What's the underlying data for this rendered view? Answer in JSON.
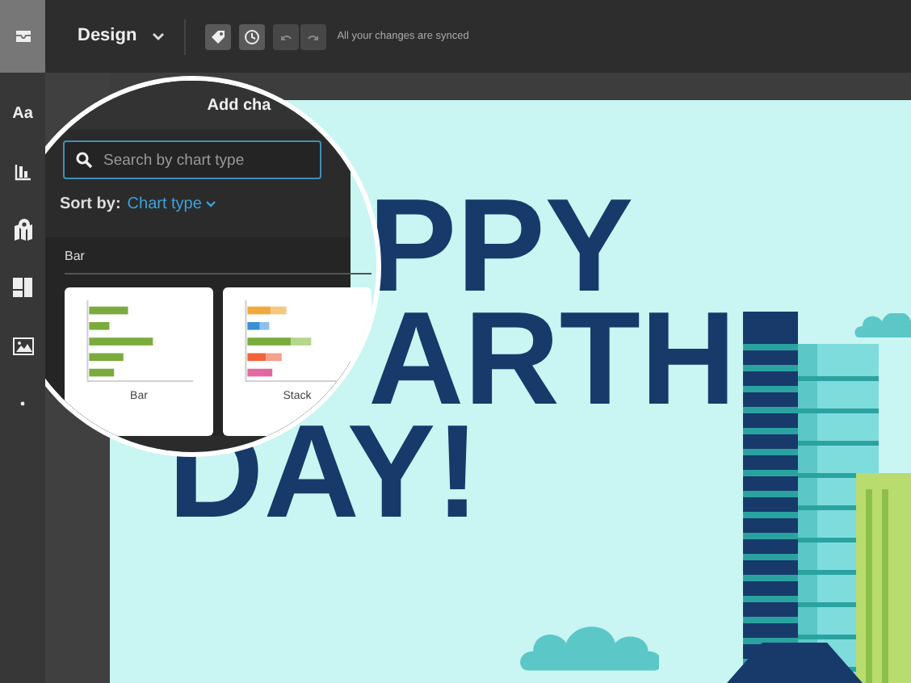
{
  "toolbar": {
    "menu_label": "Design",
    "history_buttons": [
      {
        "kind": "undo",
        "disabled": true
      },
      {
        "kind": "redo",
        "disabled": true
      }
    ],
    "sync_status": "All your changes are synced"
  },
  "rail": {
    "text_tool_label": "Aa"
  },
  "panel": {
    "title": "Add cha",
    "search": {
      "placeholder": "Search by chart type"
    },
    "sort_label": "Sort by:",
    "sort_value": "Chart type",
    "section": "Bar",
    "cards": [
      {
        "label": "Bar",
        "kind": "bar"
      },
      {
        "label": "Stack",
        "kind": "stacked"
      }
    ]
  },
  "poster": {
    "lines": [
      "PPY",
      "ARTH",
      "DAY!"
    ]
  }
}
